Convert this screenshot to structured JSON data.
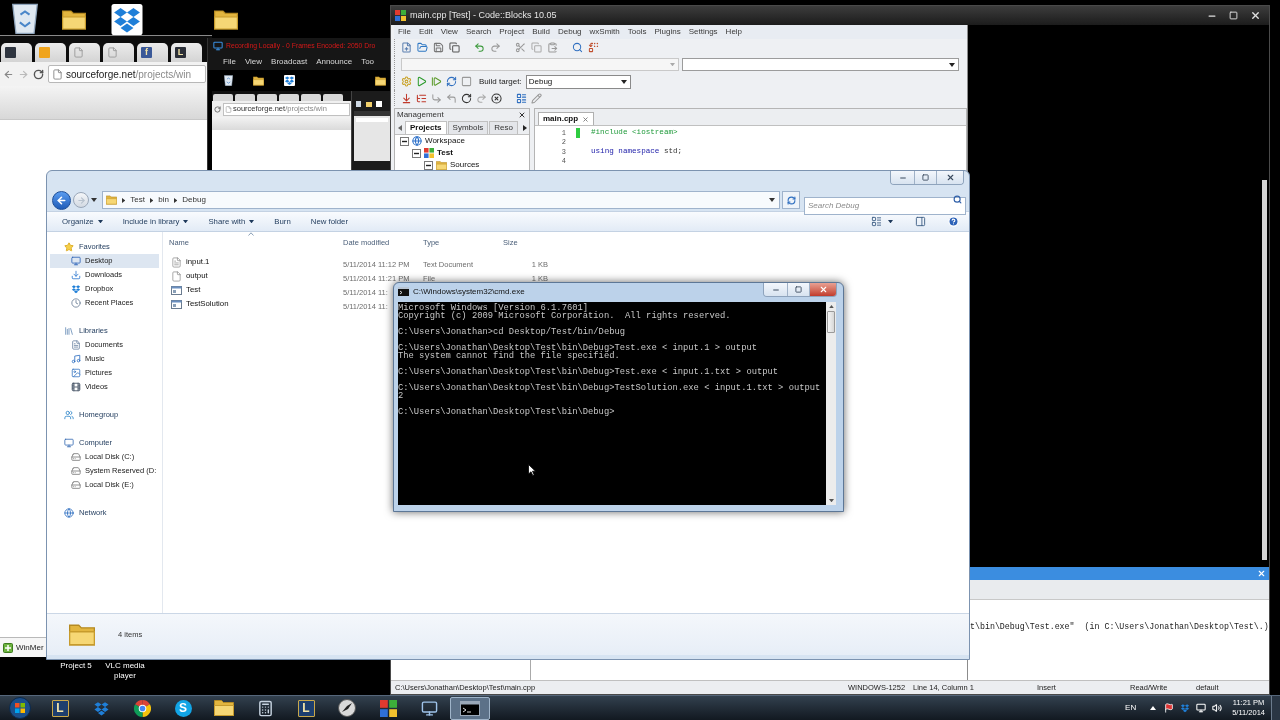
{
  "desktop": {
    "labels": [
      "Project 5",
      "VLC media player"
    ]
  },
  "browser": {
    "tabs": [
      {
        "kind": "tile",
        "color": "#2f3540"
      },
      {
        "kind": "tile",
        "color": "#f0a41c"
      },
      {
        "kind": "page"
      },
      {
        "kind": "page"
      },
      {
        "kind": "tile",
        "letter": "f",
        "color": "#3b5998"
      },
      {
        "kind": "tile",
        "letter": "L",
        "color": "#2b2f38"
      }
    ],
    "address": {
      "host": "sourceforge.net",
      "path": "/projects/win"
    },
    "download": "WinMer"
  },
  "recorder": {
    "title": "Recording Locally - 0 Frames Encoded: 2050 Dro",
    "menu": [
      "File",
      "View",
      "Broadcast",
      "Announce",
      "Too"
    ],
    "preview": {
      "address": {
        "host": "sourceforge.net",
        "path": "/projects/win"
      }
    }
  },
  "codeblocks": {
    "title": "main.cpp [Test] - Code::Blocks 10.05",
    "menu": [
      "File",
      "Edit",
      "View",
      "Search",
      "Project",
      "Build",
      "Debug",
      "wxSmith",
      "Tools",
      "Plugins",
      "Settings",
      "Help"
    ],
    "build_target": {
      "label": "Build target:",
      "value": "Debug"
    },
    "management": {
      "title": "Management",
      "tabs": [
        {
          "label": "Projects",
          "selected": true
        },
        {
          "label": "Symbols",
          "selected": false
        },
        {
          "label": "Reso",
          "selected": false
        }
      ],
      "tree": [
        {
          "label": "Workspace",
          "kind": "workspace",
          "active": false,
          "expanded": true,
          "children": [
            {
              "label": "Test",
              "kind": "project",
              "active": true,
              "expanded": true,
              "children": [
                {
                  "label": "Sources",
                  "kind": "folder",
                  "active": false,
                  "expanded": true
                }
              ]
            }
          ]
        }
      ]
    },
    "editor": {
      "tabs": [
        {
          "label": "main.cpp",
          "selected": true
        }
      ],
      "lines": [
        {
          "number": "1",
          "changed": true,
          "tokens": [
            {
              "text": "#include <iostream>",
              "kind": "preprocessor"
            }
          ]
        },
        {
          "number": "2",
          "changed": false
        },
        {
          "number": "3",
          "changed": false,
          "tokens": [
            {
              "text": "using",
              "kind": "keyword"
            },
            {
              "text": "namespace",
              "kind": "keyword"
            },
            {
              "text": "std;",
              "kind": "plain"
            }
          ]
        },
        {
          "number": "4",
          "changed": false
        }
      ]
    },
    "log": "t\\bin\\Debug\\Test.exe\"  (in C:\\Users\\Jonathan\\Desktop\\Test\\.)",
    "status_bar": [
      "C:\\Users\\Jonathan\\Desktop\\Test\\main.cpp",
      "WINDOWS-1252",
      "Line 14, Column 1",
      "Insert",
      "Read/Write",
      "default"
    ]
  },
  "explorer": {
    "breadcrumb": [
      "Test",
      "bin",
      "Debug"
    ],
    "search": {
      "placeholder": "Search Debug"
    },
    "toolbar": [
      {
        "label": "Organize",
        "dropdown": true
      },
      {
        "label": "Include in library",
        "dropdown": true
      },
      {
        "label": "Share with",
        "dropdown": true
      },
      {
        "label": "Burn",
        "dropdown": false
      },
      {
        "label": "New folder",
        "dropdown": false
      }
    ],
    "nav": [
      {
        "label": "Favorites",
        "kind": "star",
        "selected": false,
        "children": [
          {
            "label": "Desktop",
            "kind": "desktop",
            "selected": true
          },
          {
            "label": "Downloads",
            "kind": "downloads",
            "selected": false
          },
          {
            "label": "Dropbox",
            "kind": "dropbox",
            "selected": false
          },
          {
            "label": "Recent Places",
            "kind": "recent",
            "selected": false
          }
        ]
      },
      {
        "label": "Libraries",
        "kind": "library",
        "selected": false,
        "children": [
          {
            "label": "Documents",
            "kind": "documents",
            "selected": false
          },
          {
            "label": "Music",
            "kind": "music",
            "selected": false
          },
          {
            "label": "Pictures",
            "kind": "pictures",
            "selected": false
          },
          {
            "label": "Videos",
            "kind": "videos",
            "selected": false
          }
        ]
      },
      {
        "label": "Homegroup",
        "kind": "homegroup",
        "selected": false
      },
      {
        "label": "Computer",
        "kind": "computer",
        "selected": false,
        "children": [
          {
            "label": "Local Disk (C:)",
            "kind": "drive",
            "selected": false
          },
          {
            "label": "System Reserved (D:",
            "kind": "drive",
            "selected": false
          },
          {
            "label": "Local Disk (E:)",
            "kind": "drive",
            "selected": false
          }
        ]
      },
      {
        "label": "Network",
        "kind": "network",
        "selected": false
      }
    ],
    "columns": [
      {
        "label": "Name",
        "sorted": true
      },
      {
        "label": "Date modified",
        "sorted": false
      },
      {
        "label": "Type",
        "sorted": false
      },
      {
        "label": "Size",
        "sorted": false
      }
    ],
    "rows": [
      {
        "name": "input.1",
        "kind": "text-document",
        "date": "5/11/2014 11:12 PM",
        "type": "Text Document",
        "size": "1 KB"
      },
      {
        "name": "output",
        "kind": "file",
        "date": "5/11/2014 11:21 PM",
        "type": "File",
        "size": "1 KB"
      },
      {
        "name": "Test",
        "kind": "application",
        "date": "5/11/2014 11:"
      },
      {
        "name": "TestSolution",
        "kind": "application",
        "date": "5/11/2014 11:"
      }
    ],
    "status": "4 items"
  },
  "cmd": {
    "title": "C:\\Windows\\system32\\cmd.exe",
    "blocks": [
      [
        "Microsoft Windows [Version 6.1.7601]",
        "Copyright (c) 2009 Microsoft Corporation.  All rights reserved."
      ],
      [
        "C:\\Users\\Jonathan>cd Desktop/Test/bin/Debug"
      ],
      [
        "C:\\Users\\Jonathan\\Desktop\\Test\\bin\\Debug>Test.exe < input.1 > output",
        "The system cannot find the file specified."
      ],
      [
        "C:\\Users\\Jonathan\\Desktop\\Test\\bin\\Debug>Test.exe < input.1.txt > output"
      ],
      [
        "C:\\Users\\Jonathan\\Desktop\\Test\\bin\\Debug>TestSolution.exe < input.1.txt > output",
        "2"
      ],
      [
        "C:\\Users\\Jonathan\\Desktop\\Test\\bin\\Debug>"
      ]
    ]
  },
  "taskbar": {
    "apps": [
      {
        "kind": "tile",
        "letter": "L",
        "color": "#1d3e6e",
        "selected": false
      },
      {
        "kind": "box",
        "selected": false
      },
      {
        "kind": "ring",
        "selected": false
      },
      {
        "kind": "circle",
        "letter": "S",
        "color": "#12a5e6",
        "selected": false
      },
      {
        "kind": "folder",
        "selected": false
      },
      {
        "kind": "calculator",
        "selected": false
      },
      {
        "kind": "tile",
        "letter": "L",
        "color": "#1d3e6e",
        "selected": false
      },
      {
        "kind": "disc",
        "selected": false
      },
      {
        "kind": "squares",
        "selected": false
      },
      {
        "kind": "monitor",
        "selected": false
      },
      {
        "kind": "console",
        "selected": true
      }
    ],
    "language": "EN",
    "clock": {
      "time": "11:21 PM",
      "date": "5/11/2014"
    }
  }
}
